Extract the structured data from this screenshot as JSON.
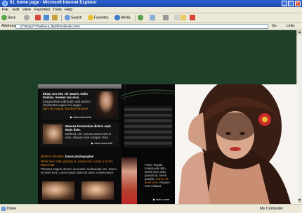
{
  "window": {
    "title": "01_home page - Microsoft Internet Explorer"
  },
  "menu": [
    "File",
    "Edit",
    "View",
    "Favorites",
    "Tools",
    "Help"
  ],
  "toolbar": {
    "back": "Back",
    "search": "Search",
    "favorites": "Favorites",
    "media": "Media"
  },
  "address": {
    "label": "Address",
    "url": "D:\\Temp\\777\\without_flash\\html\\index.html",
    "go": "Go",
    "links": "Links"
  },
  "status": {
    "text": "Done",
    "zone": "My Computer"
  },
  "site": {
    "block1": {
      "heading": "Etiam con elec vel mauris. Nulla facilisis. Aenean nec eros.",
      "body": "Suspendisse sollicitudin velit sed leo. Ut pharetra augue nec augue.",
      "link": "Nam elit magna, hendrerit sit amet.",
      "more": "view more info"
    },
    "block2": {
      "heading": "Maecen Fermentum dictum erpit. Nunc dum.",
      "body": "Eleifend, elit. Aenean auctor wisi et urna. Aliquam erat volutpat. Duis.",
      "more": "view more info"
    },
    "block3": {
      "name": "MARKO MAKEIN",
      "role": "fasion photographer",
      "link": "Morbi nunc odio, gravida at, cursus nec, luctus a, lorem. Maecenas",
      "body": "Pharetra magna. Donec accumsan malesuada orci. Donec sit amet eros. Lorem ipsum dolor sit amet, consectetuer."
    },
    "middle": {
      "text": "Fusce feugiat malesuada odio. Morbi nunc odio, gravida at, lorem gravida.",
      "link": "Donec sit amet eros.",
      "tail": "Aliquam erat volutpat.",
      "more": "learn more"
    }
  }
}
